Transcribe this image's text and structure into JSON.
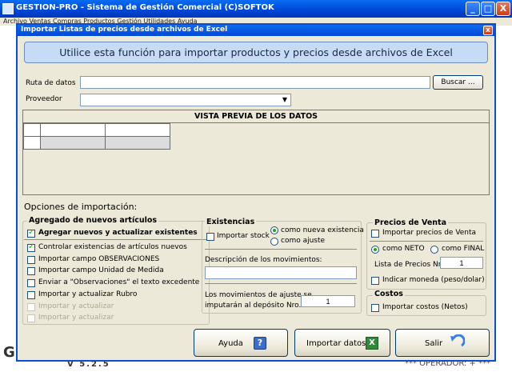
{
  "app": {
    "title": "GESTION-PRO  -  Sistema de Gestión Comercial  (C)SOFTOK",
    "menu_text": "Archivo  Ventas  Compras  Productos  Gestión  Utilidades  Ayuda",
    "version": "V 5.2.5",
    "operator": "***  OPERADOR: +  ***",
    "logo_letter": "G",
    "minimize": "_",
    "maximize": "□",
    "close": "X"
  },
  "dialog": {
    "title": "Importar Listas de precios desde archivos de Excel",
    "close": "x",
    "banner": "Utilice esta función para importar productos y precios desde archivos de Excel",
    "ruta_label": "Ruta de datos",
    "ruta_value": "",
    "buscar_label": "Buscar ...",
    "proveedor_label": "Proveedor",
    "proveedor_value": "",
    "preview_title": "VISTA PREVIA DE LOS DATOS",
    "options_title": "Opciones de importación:",
    "agregado": {
      "title": "Agregado de nuevos artículos",
      "items": [
        {
          "label": "Agregar nuevos y actualizar existentes",
          "checked": true,
          "bold": true,
          "enabled": true
        },
        {
          "label": "Controlar existencias de artículos nuevos",
          "checked": true,
          "bold": false,
          "enabled": true
        },
        {
          "label": "Importar campo OBSERVACIONES",
          "checked": false,
          "bold": false,
          "enabled": true
        },
        {
          "label": "Importar campo Unidad de Medida",
          "checked": false,
          "bold": false,
          "enabled": true
        },
        {
          "label": "Enviar a \"Observaciones\" el texto excedente",
          "checked": false,
          "bold": false,
          "enabled": true
        },
        {
          "label": "Importar y actualizar Rubro",
          "checked": false,
          "bold": false,
          "enabled": true
        },
        {
          "label": "Importar y actualizar",
          "checked": false,
          "bold": false,
          "enabled": false
        },
        {
          "label": "Importar y actualizar",
          "checked": false,
          "bold": false,
          "enabled": false
        }
      ]
    },
    "existencias": {
      "title": "Existencias",
      "importar_stock": "Importar stock",
      "radio_nueva": "como nueva existencia",
      "radio_ajuste": "como ajuste",
      "desc_label": "Descripción de los movimientos:",
      "desc_value": "",
      "deposito_label_1": "Los movimientos de ajuste se",
      "deposito_label_2": "imputarán al depósito  Nro.:",
      "deposito_value": "1"
    },
    "precios": {
      "title": "Precios de Venta",
      "importar_precios": "Importar precios de Venta",
      "radio_neto": "como NETO",
      "radio_final": "como FINAL",
      "lista_label": "Lista de Precios Nro.:",
      "lista_value": "1",
      "indicar_moneda": "Indicar moneda (peso/dolar)"
    },
    "costos": {
      "title": "Costos",
      "importar_costos": "Importar costos (Netos)"
    },
    "buttons": {
      "ayuda": "Ayuda",
      "importar": "Importar datos",
      "salir": "Salir"
    }
  }
}
